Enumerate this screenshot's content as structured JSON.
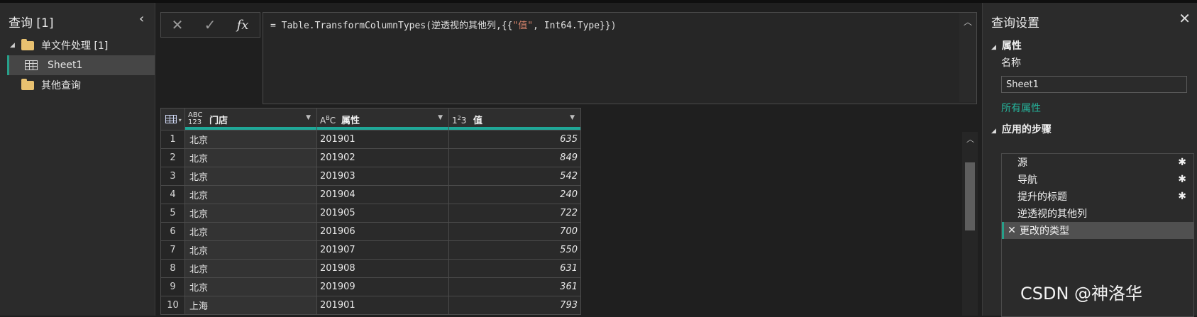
{
  "queries_pane": {
    "title": "查询 [1]",
    "groups": [
      {
        "label": "单文件处理 [1]",
        "children": [
          {
            "label": "Sheet1"
          }
        ]
      },
      {
        "label": "其他查询"
      }
    ]
  },
  "formula_bar": {
    "prefix": "= Table.TransformColumnTypes(逆透视的其他列,{{",
    "string_literal": "\"值\"",
    "suffix": ", Int64.Type}})"
  },
  "grid": {
    "columns": [
      {
        "type_icon": "ABC\n123",
        "label": "门店"
      },
      {
        "type_icon": "ABC",
        "label": "属性"
      },
      {
        "type_icon": "123",
        "label": "值"
      }
    ],
    "rows": [
      {
        "n": "1",
        "store": "北京",
        "attr": "201901",
        "value": "635"
      },
      {
        "n": "2",
        "store": "北京",
        "attr": "201902",
        "value": "849"
      },
      {
        "n": "3",
        "store": "北京",
        "attr": "201903",
        "value": "542"
      },
      {
        "n": "4",
        "store": "北京",
        "attr": "201904",
        "value": "240"
      },
      {
        "n": "5",
        "store": "北京",
        "attr": "201905",
        "value": "722"
      },
      {
        "n": "6",
        "store": "北京",
        "attr": "201906",
        "value": "700"
      },
      {
        "n": "7",
        "store": "北京",
        "attr": "201907",
        "value": "550"
      },
      {
        "n": "8",
        "store": "北京",
        "attr": "201908",
        "value": "631"
      },
      {
        "n": "9",
        "store": "北京",
        "attr": "201909",
        "value": "361"
      },
      {
        "n": "10",
        "store": "上海",
        "attr": "201901",
        "value": "793"
      }
    ],
    "header_accent": "#1fa898"
  },
  "settings_pane": {
    "title": "查询设置",
    "properties_header": "属性",
    "name_label": "名称",
    "name_value": "Sheet1",
    "all_properties_link": "所有属性",
    "steps_header": "应用的步骤",
    "steps": [
      {
        "label": "源",
        "has_gear": true
      },
      {
        "label": "导航",
        "has_gear": true
      },
      {
        "label": "提升的标题",
        "has_gear": true
      },
      {
        "label": "逆透视的其他列",
        "has_gear": false
      },
      {
        "label": "更改的类型",
        "has_gear": false,
        "active": true
      }
    ]
  },
  "watermark": "CSDN @神洛华"
}
